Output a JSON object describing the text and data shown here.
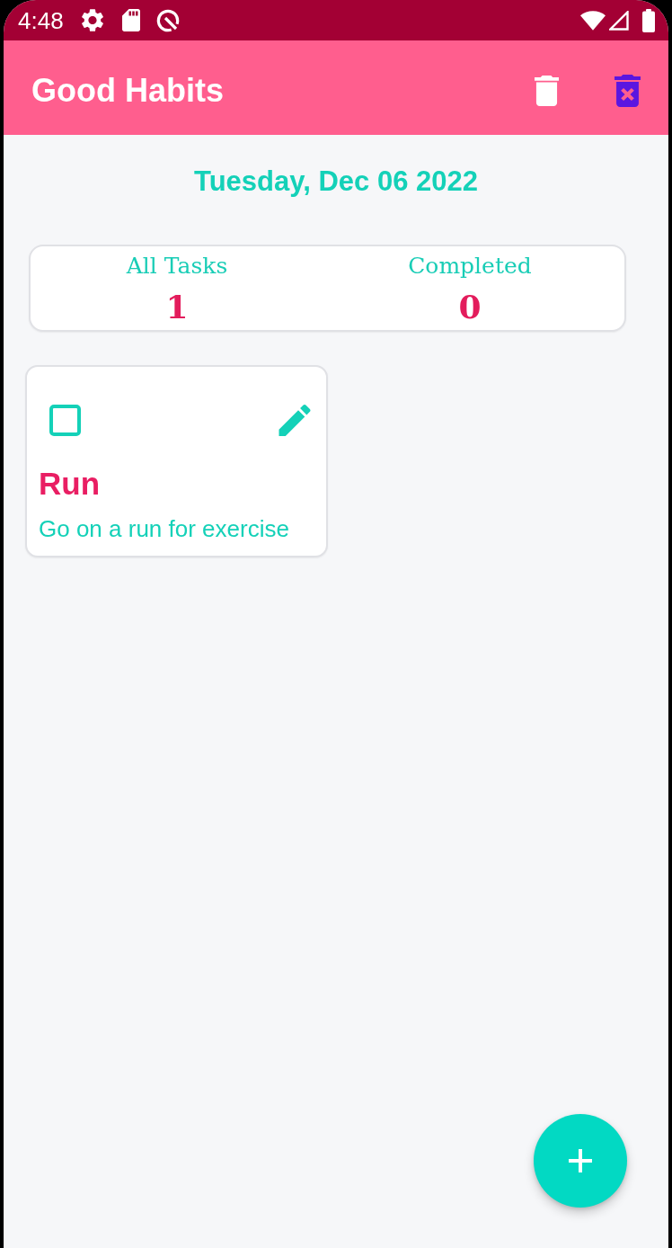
{
  "status_bar": {
    "time": "4:48"
  },
  "app_bar": {
    "title": "Good Habits"
  },
  "date": "Tuesday, Dec 06 2022",
  "stats": [
    {
      "label": "All Tasks",
      "value": "1"
    },
    {
      "label": "Completed",
      "value": "0"
    }
  ],
  "tasks": [
    {
      "title": "Run",
      "description": "Go on a run for exercise",
      "checked": false
    }
  ]
}
